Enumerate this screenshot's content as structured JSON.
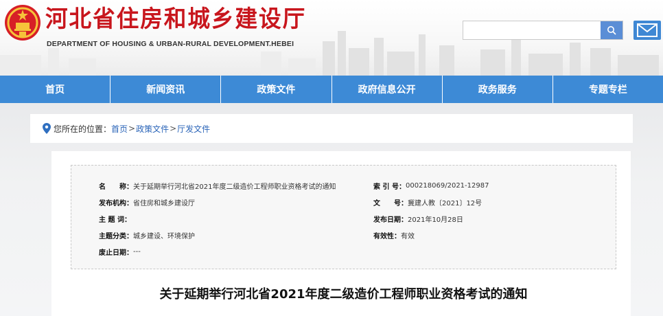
{
  "header": {
    "title": "河北省住房和城乡建设厅",
    "subtitle": "DEPARTMENT OF HOUSING & URBAN-RURAL DEVELOPMENT.HEBEI",
    "search": {
      "placeholder": "",
      "icon": "search-icon"
    },
    "mail_icon": "mail-icon"
  },
  "nav": {
    "items": [
      {
        "label": "首页"
      },
      {
        "label": "新闻资讯"
      },
      {
        "label": "政策文件"
      },
      {
        "label": "政府信息公开"
      },
      {
        "label": "政务服务"
      },
      {
        "label": "专题专栏"
      }
    ]
  },
  "breadcrumb": {
    "prefix": "您所在的位置：",
    "items": [
      "首页",
      "政策文件",
      "厅发文件"
    ],
    "separator": ">"
  },
  "meta": {
    "name": {
      "label": "名　　称：",
      "value": "关于延期举行河北省2021年度二级造价工程师职业资格考试的通知"
    },
    "issuer": {
      "label": "发布机构：",
      "value": "省住房和城乡建设厅"
    },
    "keywords": {
      "label": "主 题 词：",
      "value": ""
    },
    "category": {
      "label": "主题分类：",
      "value": "城乡建设、环境保护"
    },
    "expiry": {
      "label": "废止日期：",
      "value": "---"
    },
    "index_no": {
      "label": "索 引 号：",
      "value": "000218069/2021-12987"
    },
    "doc_no": {
      "label": "文　　号：",
      "value": "冀建人教〔2021〕12号"
    },
    "publish_date": {
      "label": "发布日期：",
      "value": "2021年10月28日"
    },
    "validity": {
      "label": "有效性：",
      "value": "有效"
    }
  },
  "article": {
    "title": "关于延期举行河北省2021年度二级造价工程师职业资格考试的通知"
  },
  "colors": {
    "brand_red": "#c8161d",
    "nav_blue": "#3d8ad6",
    "link_blue": "#2a64b8"
  }
}
